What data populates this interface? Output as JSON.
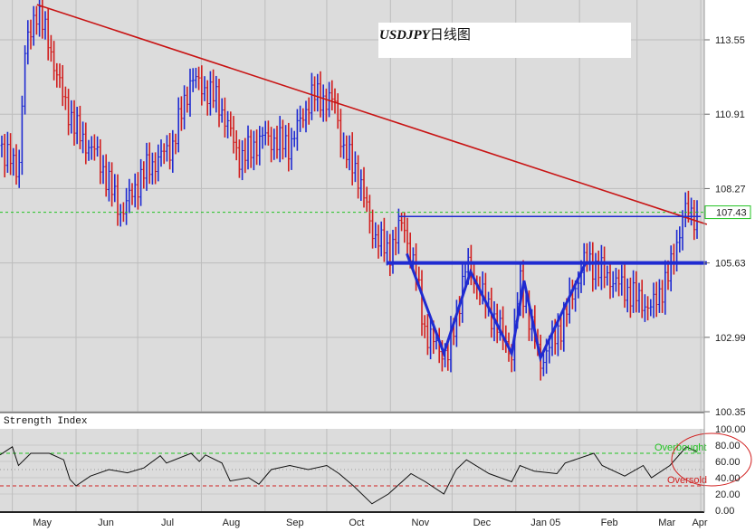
{
  "chart_data": [
    {
      "type": "candlestick",
      "title": "USDJPY日线图",
      "title_parts": [
        "USDJPY",
        "日线图"
      ],
      "y_ticks": [
        "113.55",
        "110.91",
        "108.27",
        "105.63",
        "102.99",
        "100.35"
      ],
      "ylim": [
        100.35,
        115.0
      ],
      "x_labels": [
        "May",
        "Jun",
        "Jul",
        "Aug",
        "Sep",
        "Oct",
        "Nov",
        "Dec",
        "Jan 05",
        "Feb",
        "Mar",
        "Apr"
      ],
      "xlim": [
        "2004-04-25",
        "2005-04-04"
      ],
      "grid": true,
      "up_color": "#1f2bd1",
      "down_color": "#d11f1f",
      "price_path": [
        [
          "2004-04-25",
          109.8
        ],
        [
          "2004-05-04",
          108.85
        ],
        [
          "2004-05-07",
          113.0
        ],
        [
          "2004-05-13",
          114.7
        ],
        [
          "2004-05-19",
          113.35
        ],
        [
          "2004-05-26",
          111.4
        ],
        [
          "2004-06-03",
          110.1
        ],
        [
          "2004-06-11",
          109.5
        ],
        [
          "2004-06-23",
          107.4
        ],
        [
          "2004-07-04",
          108.85
        ],
        [
          "2004-07-18",
          109.8
        ],
        [
          "2004-07-27",
          112.2
        ],
        [
          "2004-08-09",
          111.4
        ],
        [
          "2004-08-20",
          109.3
        ],
        [
          "2004-08-31",
          110.1
        ],
        [
          "2004-09-13",
          109.8
        ],
        [
          "2004-09-24",
          111.6
        ],
        [
          "2004-10-05",
          111.3
        ],
        [
          "2004-10-09",
          109.65
        ],
        [
          "2004-10-16",
          108.85
        ],
        [
          "2004-10-23",
          106.8
        ],
        [
          "2004-10-31",
          105.95
        ],
        [
          "2004-11-07",
          107.1
        ],
        [
          "2004-11-14",
          105.0
        ],
        [
          "2004-11-18",
          103.1
        ],
        [
          "2004-11-29",
          102.3
        ],
        [
          "2004-12-08",
          105.6
        ],
        [
          "2004-12-19",
          104.0
        ],
        [
          "2004-12-30",
          102.4
        ],
        [
          "2005-01-03",
          105.0
        ],
        [
          "2005-01-13",
          102.1
        ],
        [
          "2005-01-23",
          103.4
        ],
        [
          "2005-02-04",
          105.8
        ],
        [
          "2005-02-12",
          105.3
        ],
        [
          "2005-02-23",
          104.7
        ],
        [
          "2005-03-08",
          104.0
        ],
        [
          "2005-03-17",
          105.3
        ],
        [
          "2005-03-24",
          107.5
        ],
        [
          "2005-03-30",
          107.25
        ]
      ],
      "last_price": "107.43",
      "last_price_color": "#22c322",
      "annotations": {
        "trendline": {
          "color": "#c81414",
          "from": [
            "2004-05-13",
            114.8
          ],
          "to": [
            "2005-04-04",
            107.0
          ]
        },
        "resistance_line": {
          "color": "#1f2bd1",
          "price": 107.28,
          "from": "2004-11-05",
          "to": "2005-04-01"
        },
        "neckline": {
          "color": "#1f2bd1",
          "price": 105.63,
          "from": "2004-10-30",
          "to": "2005-04-04"
        },
        "pattern": {
          "color": "#1f2bd1",
          "points": [
            [
              "2004-11-09",
              105.96
            ],
            [
              "2004-11-27",
              102.42
            ],
            [
              "2004-12-10",
              105.32
            ],
            [
              "2004-12-30",
              102.42
            ],
            [
              "2005-01-05",
              105.0
            ],
            [
              "2005-01-13",
              102.26
            ],
            [
              "2005-02-04",
              105.64
            ]
          ]
        }
      }
    },
    {
      "type": "line",
      "title": "Strength Index",
      "y_ticks": [
        "100.00",
        "80.00",
        "60.00",
        "40.00",
        "20.00",
        "0.00"
      ],
      "ylim": [
        0,
        100
      ],
      "overbought": {
        "value": 70,
        "label": "Overbought",
        "color": "#22c322"
      },
      "oversold": {
        "value": 30,
        "label": "Oversold",
        "color": "#d11f1f"
      },
      "midline": 50,
      "highlight_color": "#d11f1f",
      "series": [
        [
          "2004-04-25",
          68
        ],
        [
          "2004-05-01",
          78
        ],
        [
          "2004-05-04",
          55
        ],
        [
          "2004-05-10",
          70
        ],
        [
          "2004-05-19",
          70
        ],
        [
          "2004-05-26",
          62
        ],
        [
          "2004-05-29",
          38
        ],
        [
          "2004-06-01",
          30
        ],
        [
          "2004-06-08",
          42
        ],
        [
          "2004-06-17",
          50
        ],
        [
          "2004-06-26",
          46
        ],
        [
          "2004-07-04",
          52
        ],
        [
          "2004-07-12",
          67
        ],
        [
          "2004-07-15",
          58
        ],
        [
          "2004-07-27",
          70
        ],
        [
          "2004-07-31",
          60
        ],
        [
          "2004-08-03",
          68
        ],
        [
          "2004-08-11",
          58
        ],
        [
          "2004-08-15",
          36
        ],
        [
          "2004-08-24",
          40
        ],
        [
          "2004-08-29",
          32
        ],
        [
          "2004-09-04",
          50
        ],
        [
          "2004-09-13",
          55
        ],
        [
          "2004-09-22",
          50
        ],
        [
          "2004-10-01",
          55
        ],
        [
          "2004-10-07",
          45
        ],
        [
          "2004-10-14",
          30
        ],
        [
          "2004-10-23",
          8
        ],
        [
          "2004-10-31",
          20
        ],
        [
          "2004-11-11",
          45
        ],
        [
          "2004-11-18",
          35
        ],
        [
          "2004-11-27",
          20
        ],
        [
          "2004-12-03",
          50
        ],
        [
          "2004-12-08",
          62
        ],
        [
          "2004-12-19",
          45
        ],
        [
          "2004-12-30",
          35
        ],
        [
          "2005-01-03",
          55
        ],
        [
          "2005-01-10",
          48
        ],
        [
          "2005-01-21",
          45
        ],
        [
          "2005-01-25",
          58
        ],
        [
          "2005-02-08",
          70
        ],
        [
          "2005-02-12",
          55
        ],
        [
          "2005-02-23",
          42
        ],
        [
          "2005-03-04",
          55
        ],
        [
          "2005-03-08",
          40
        ],
        [
          "2005-03-17",
          55
        ],
        [
          "2005-03-25",
          78
        ],
        [
          "2005-03-30",
          72
        ]
      ]
    }
  ]
}
